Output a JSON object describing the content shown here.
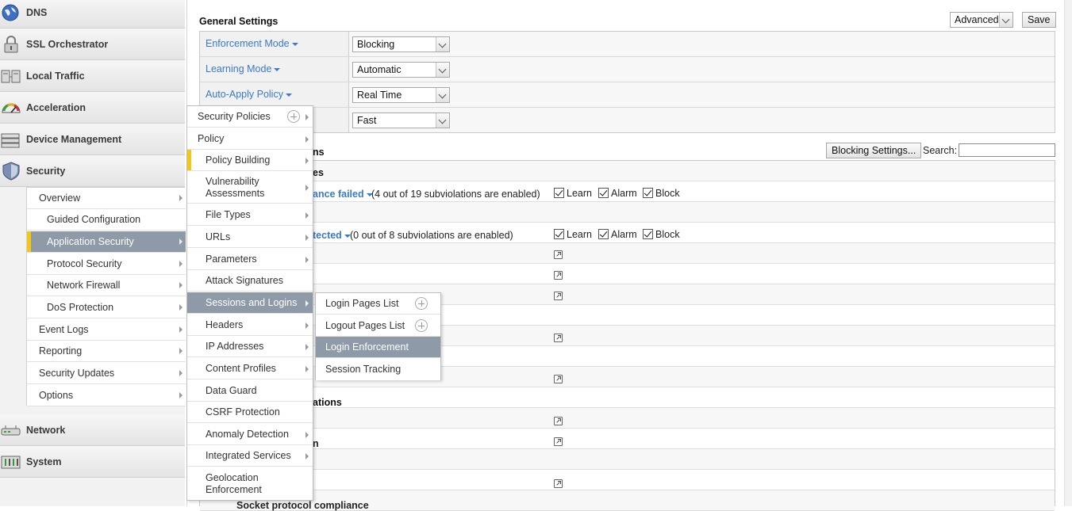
{
  "sidebar": {
    "categories": [
      {
        "label": "DNS",
        "icon": "globe-icon"
      },
      {
        "label": "SSL Orchestrator",
        "icon": "padlock-icon"
      },
      {
        "label": "Local Traffic",
        "icon": "servers-icon"
      },
      {
        "label": "Acceleration",
        "icon": "gauge-icon"
      },
      {
        "label": "Device Management",
        "icon": "device-stack-icon"
      },
      {
        "label": "Security",
        "icon": "shield-icon"
      },
      {
        "label": "Network",
        "icon": "network-switch-icon"
      },
      {
        "label": "System",
        "icon": "system-panel-icon"
      }
    ],
    "security_items": [
      {
        "label": "Overview"
      },
      {
        "label": "Guided Configuration"
      },
      {
        "label": "Application Security"
      },
      {
        "label": "Protocol Security"
      },
      {
        "label": "Network Firewall"
      },
      {
        "label": "DoS Protection"
      },
      {
        "label": "Event Logs"
      },
      {
        "label": "Reporting"
      },
      {
        "label": "Security Updates"
      },
      {
        "label": "Options"
      }
    ]
  },
  "app_security_menu": {
    "items": [
      {
        "label": "Security Policies"
      },
      {
        "label": "Policy"
      },
      {
        "label": "Policy Building"
      },
      {
        "label": "Vulnerability Assessments"
      },
      {
        "label": "File Types"
      },
      {
        "label": "URLs"
      },
      {
        "label": "Parameters"
      },
      {
        "label": "Attack Signatures"
      },
      {
        "label": "Sessions and Logins"
      },
      {
        "label": "Headers"
      },
      {
        "label": "IP Addresses"
      },
      {
        "label": "Content Profiles"
      },
      {
        "label": "Data Guard"
      },
      {
        "label": "CSRF Protection"
      },
      {
        "label": "Anomaly Detection"
      },
      {
        "label": "Integrated Services"
      },
      {
        "label": "Geolocation Enforcement"
      }
    ]
  },
  "sessions_menu": {
    "items": [
      {
        "label": "Login Pages List"
      },
      {
        "label": "Logout Pages List"
      },
      {
        "label": "Login Enforcement"
      },
      {
        "label": "Session Tracking"
      }
    ]
  },
  "general_settings": {
    "title": "General Settings",
    "view_select": "Advanced",
    "save_label": "Save",
    "rows": [
      {
        "label": "Enforcement Mode",
        "value": "Blocking"
      },
      {
        "label": "Learning Mode",
        "value": "Automatic"
      },
      {
        "label": "Auto-Apply Policy",
        "value": "Real Time"
      },
      {
        "label": "",
        "value": "Fast"
      }
    ]
  },
  "policy_violations": {
    "title_fragment": "ns",
    "blocking_settings_label": "Blocking Settings...",
    "search_label": "Search:",
    "search_value": "",
    "group1_fragment": "es",
    "row1_link_fragment": "ance failed",
    "row1_desc": "(4 out of 19 subviolations are enabled)",
    "row2_link_fragment": "tected",
    "row2_desc": "(0 out of 8 subviolations are enabled)",
    "learn_label": "Learn",
    "alarm_label": "Alarm",
    "block_label": "Block",
    "group2_fragment": "ations",
    "row_n_fragment": "n",
    "bottom_cut_label": "Socket protocol compliance"
  },
  "colors": {
    "link_blue": "#3a7ac8",
    "active_item_bg": "#8e9aa8",
    "active_marker": "#f5c518"
  }
}
